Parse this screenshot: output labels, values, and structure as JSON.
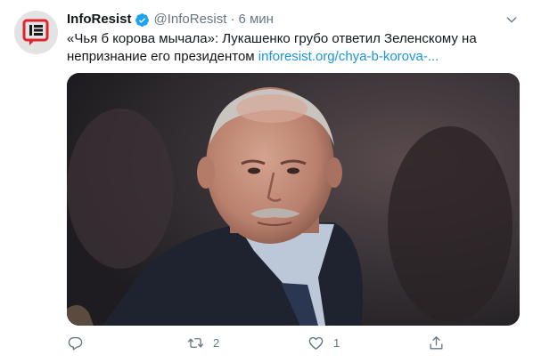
{
  "tweet": {
    "display_name": "InfoResist",
    "handle": "@InfoResist",
    "separator": "·",
    "time": "6 мин",
    "text": "«Чья б корова мычала»: Лукашенко грубо ответил Зеленскому на непризнание его президентом ",
    "link": "inforesist.org/chya-b-korova-...",
    "verified": true
  },
  "actions": {
    "reply_count": "",
    "retweet_count": "2",
    "like_count": "1"
  },
  "icons": {
    "avatar": "inforesist-logo-icon",
    "verified": "verified-badge-icon",
    "caret": "chevron-down-icon",
    "reply": "reply-icon",
    "retweet": "retweet-icon",
    "like": "heart-icon",
    "share": "share-icon"
  },
  "colors": {
    "accent": "#1da1f2",
    "link": "#1b95e0",
    "muted": "#657786",
    "logo_red": "#e0242b"
  }
}
